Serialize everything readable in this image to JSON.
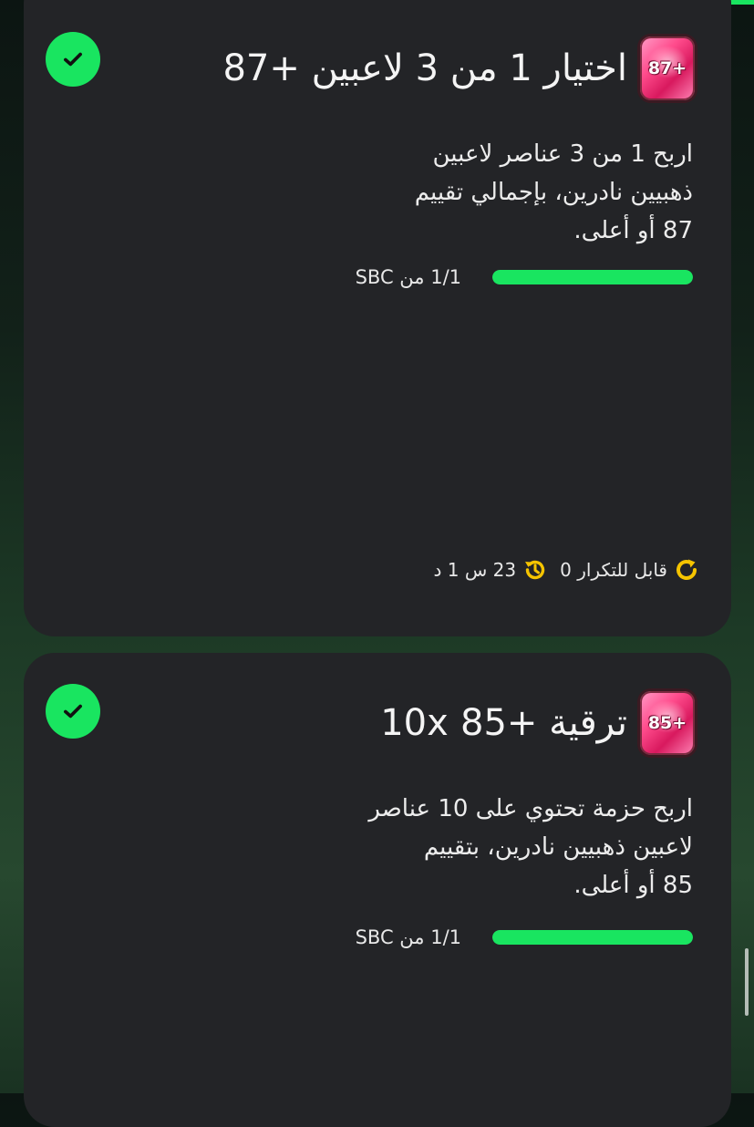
{
  "cards": [
    {
      "title": "اختيار 1 من 3 لاعبين +87",
      "pack_badge": "87+",
      "description": [
        "اربح 1 من 3 عناصر لاعبين",
        "ذهبيين نادرين، بإجمالي تقييم",
        "87 أو أعلى."
      ],
      "progress_text": "1/1 من SBC",
      "progress_fraction": 1.0,
      "completed": true,
      "repeatable_label": "قابل للتكرار 0",
      "timer_label": "23 س 1 د",
      "icons": {
        "completed": "check-icon",
        "repeat": "repeat-icon",
        "timer": "history-clock-icon"
      }
    },
    {
      "title": "ترقية +85 10x",
      "pack_badge": "85+",
      "description": [
        "اربح حزمة تحتوي على 10 عناصر",
        "لاعبين ذهبيين نادرين، بتقييم",
        "85 أو أعلى."
      ],
      "progress_text": "1/1 من SBC",
      "progress_fraction": 1.0,
      "completed": true,
      "icons": {
        "completed": "check-icon"
      }
    }
  ],
  "colors": {
    "accent_green": "#19e560",
    "card_bg": "#232427",
    "timer_yellow": "#f5c400"
  }
}
